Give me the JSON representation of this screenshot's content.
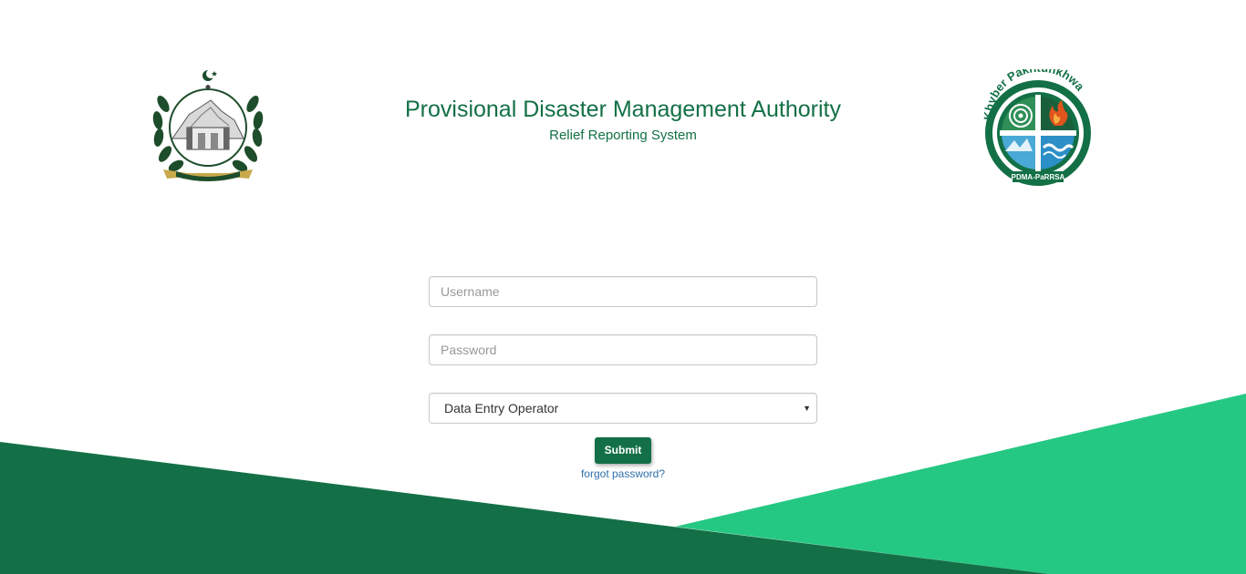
{
  "header": {
    "title": "Provisional Disaster Management Authority",
    "subtitle": "Relief Reporting System",
    "left_logo": "kp-government-emblem",
    "right_logo": "pdma-parrsa-seal"
  },
  "form": {
    "username_placeholder": "Username",
    "password_placeholder": "Password",
    "role_selected": "Data Entry Operator",
    "submit_label": "Submit",
    "forgot_label": "forgot password?"
  },
  "colors": {
    "dark_green": "#137046",
    "light_green": "#25c883",
    "link_blue": "#2f6fab"
  }
}
